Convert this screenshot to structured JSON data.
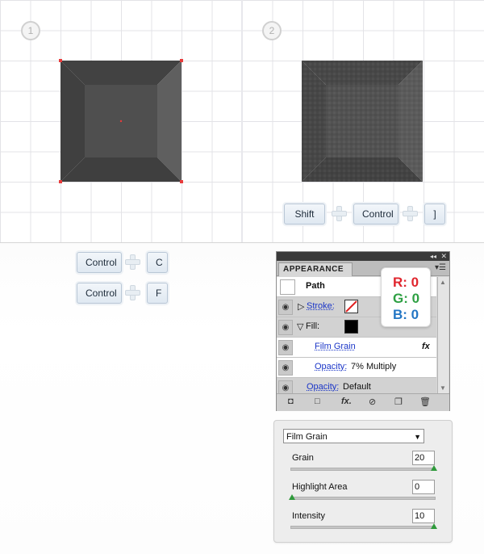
{
  "steps": {
    "step1": "1",
    "step2": "2"
  },
  "keys": {
    "shift": "Shift",
    "control": "Control",
    "bracket": "]",
    "control_c": "Control",
    "c": "C",
    "control_f": "Control",
    "f": "F"
  },
  "appearance_panel": {
    "tab": "APPEARANCE",
    "menu_icon": "panel-menu-icon",
    "path_label": "Path",
    "stroke_label": "Stroke:",
    "fill_label": "Fill:",
    "fill_color": "#000000",
    "effect_label": "Film Grain",
    "fx_label": "fx",
    "opacity_label": "Opacity:",
    "opacity_value": "7% Multiply",
    "default_opacity_label": "Opacity:",
    "default_opacity_value": "Default"
  },
  "rgb": {
    "r": "R: 0",
    "g": "G: 0",
    "b": "B: 0"
  },
  "film_grain": {
    "filter": "Film Grain",
    "grain_label": "Grain",
    "grain_value": "20",
    "highlight_label": "Highlight Area",
    "highlight_value": "0",
    "intensity_label": "Intensity",
    "intensity_value": "10"
  },
  "colors": {
    "selection": "#e83b3b",
    "slider_thumb": "#2f9a3b",
    "link": "#1a35c7"
  }
}
